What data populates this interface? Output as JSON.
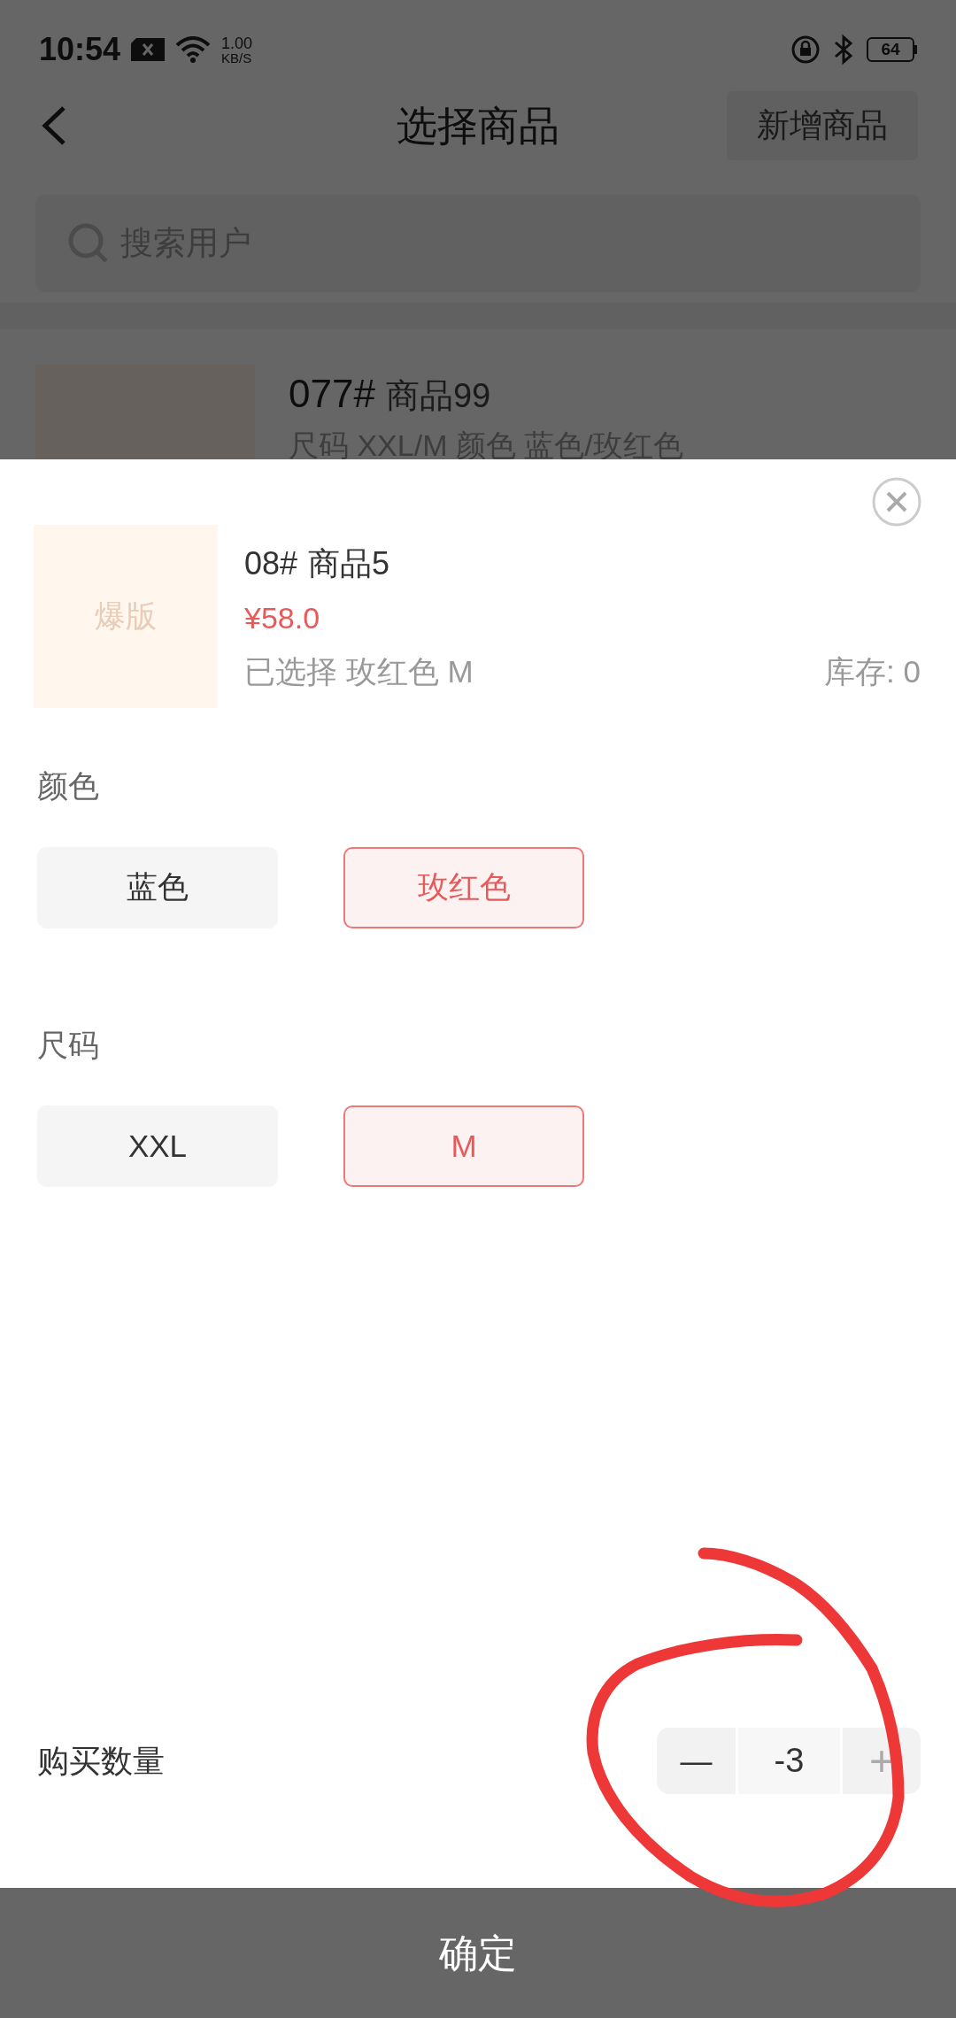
{
  "status_bar": {
    "time": "10:54",
    "speed_value": "1.00",
    "speed_unit": "KB/S",
    "battery": "64"
  },
  "header": {
    "title": "选择商品",
    "action": "新增商品"
  },
  "search": {
    "placeholder": "搜索用户"
  },
  "list": [
    {
      "code": "077#",
      "name": "商品99",
      "details": "尺码 XXL/M  颜色 蓝色/玫红色"
    }
  ],
  "sheet": {
    "image_label": "爆版",
    "code": "08#",
    "name": "商品5",
    "price": "¥58.0",
    "selected_text": "已选择 玫红色 M",
    "stock": "库存: 0",
    "groups": [
      {
        "title": "颜色",
        "options": [
          {
            "label": "蓝色",
            "selected": false
          },
          {
            "label": "玫红色",
            "selected": true
          }
        ]
      },
      {
        "title": "尺码",
        "options": [
          {
            "label": "XXL",
            "selected": false
          },
          {
            "label": "M",
            "selected": true
          }
        ]
      }
    ],
    "quantity": {
      "label": "购买数量",
      "minus": "—",
      "value": "-3",
      "plus": "+",
      "minus_disabled": false,
      "plus_disabled": true
    },
    "confirm": "确定"
  }
}
